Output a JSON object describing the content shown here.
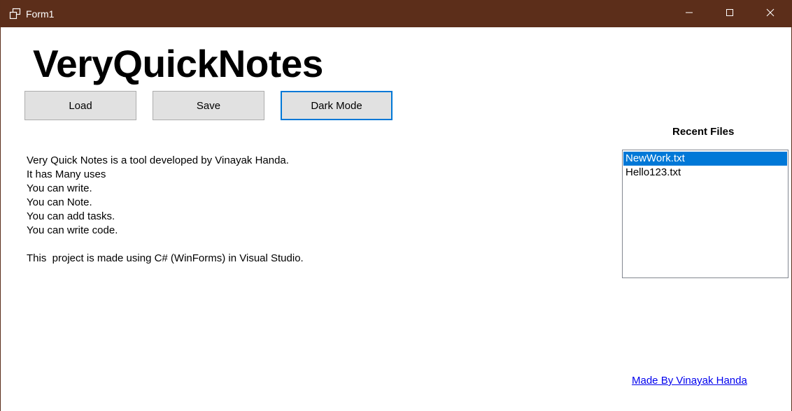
{
  "window": {
    "title": "Form1",
    "app_icon": "restore-windows-icon",
    "controls": {
      "minimize_icon": "minimize-icon",
      "maximize_icon": "maximize-icon",
      "close_icon": "close-icon"
    },
    "titlebar_color": "#5c2e1a"
  },
  "header": {
    "title": "VeryQuickNotes"
  },
  "toolbar": {
    "load_label": "Load",
    "save_label": "Save",
    "dark_mode_label": "Dark Mode"
  },
  "notes": {
    "lines": [
      "Very Quick Notes is a tool developed by Vinayak Handa.",
      "It has Many uses",
      "You can write.",
      "You can Note.",
      "You can add tasks.",
      "You can write code.",
      "",
      "This  project is made using C# (WinForms) in Visual Studio."
    ]
  },
  "recent": {
    "label": "Recent Files",
    "items": [
      {
        "label": "NewWork.txt",
        "selected": true
      },
      {
        "label": "Hello123.txt",
        "selected": false
      }
    ],
    "selection_color": "#0078d7"
  },
  "footer": {
    "link_text": "Made By Vinayak Handa"
  }
}
